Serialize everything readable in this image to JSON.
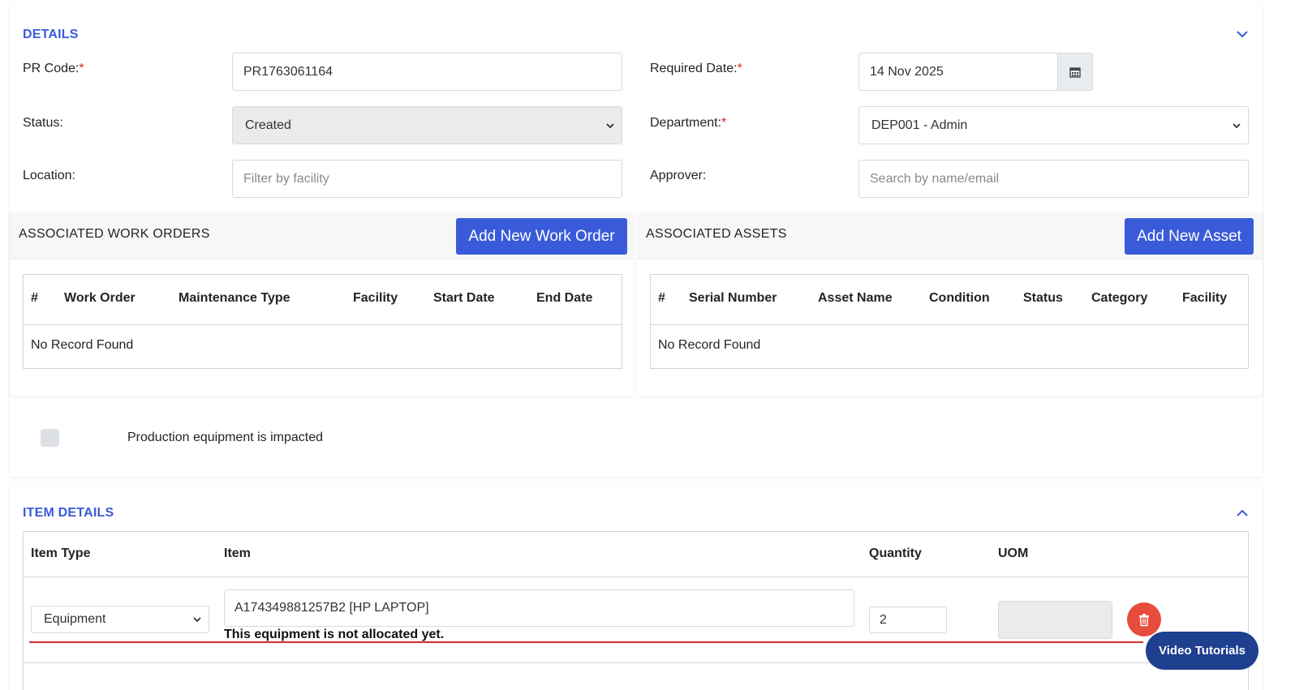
{
  "details": {
    "title": "DETAILS",
    "pr_code_label": "PR Code:",
    "pr_code_value": "PR1763061164",
    "required_date_label": "Required Date:",
    "required_date_value": "14 Nov 2025",
    "status_label": "Status:",
    "status_value": "Created",
    "department_label": "Department:",
    "department_value": "DEP001 - Admin",
    "location_label": "Location:",
    "location_placeholder": "Filter by facility",
    "approver_label": "Approver:",
    "approver_placeholder": "Search by name/email",
    "required_mark": "*"
  },
  "work_orders": {
    "title": "ASSOCIATED WORK ORDERS",
    "add_button": "Add New Work Order",
    "columns": [
      "#",
      "Work Order",
      "Maintenance Type",
      "Facility",
      "Start Date",
      "End Date"
    ],
    "empty_text": "No Record Found"
  },
  "assets": {
    "title": "ASSOCIATED ASSETS",
    "add_button": "Add New Asset",
    "columns": [
      "#",
      "Serial Number",
      "Asset Name",
      "Condition",
      "Status",
      "Category",
      "Facility"
    ],
    "empty_text": "No Record Found"
  },
  "production": {
    "label": "Production equipment is impacted",
    "checked": false
  },
  "item_details": {
    "title": "ITEM DETAILS",
    "columns": [
      "Item Type",
      "Item",
      "Quantity",
      "UOM"
    ],
    "row": {
      "item_type": "Equipment",
      "item": "A174349881257B2 [HP LAPTOP]",
      "quantity": "2",
      "uom": "",
      "warning": "This equipment is not allocated yet."
    }
  },
  "video_tutorials": "Video Tutorials",
  "colors": {
    "accent": "#3a5bd9",
    "danger": "#e74c3c",
    "floating_button": "#1f3f8f"
  },
  "icons": [
    "chevron-down-icon",
    "chevron-up-icon",
    "calendar-icon",
    "caret-down-icon",
    "trash-icon"
  ]
}
